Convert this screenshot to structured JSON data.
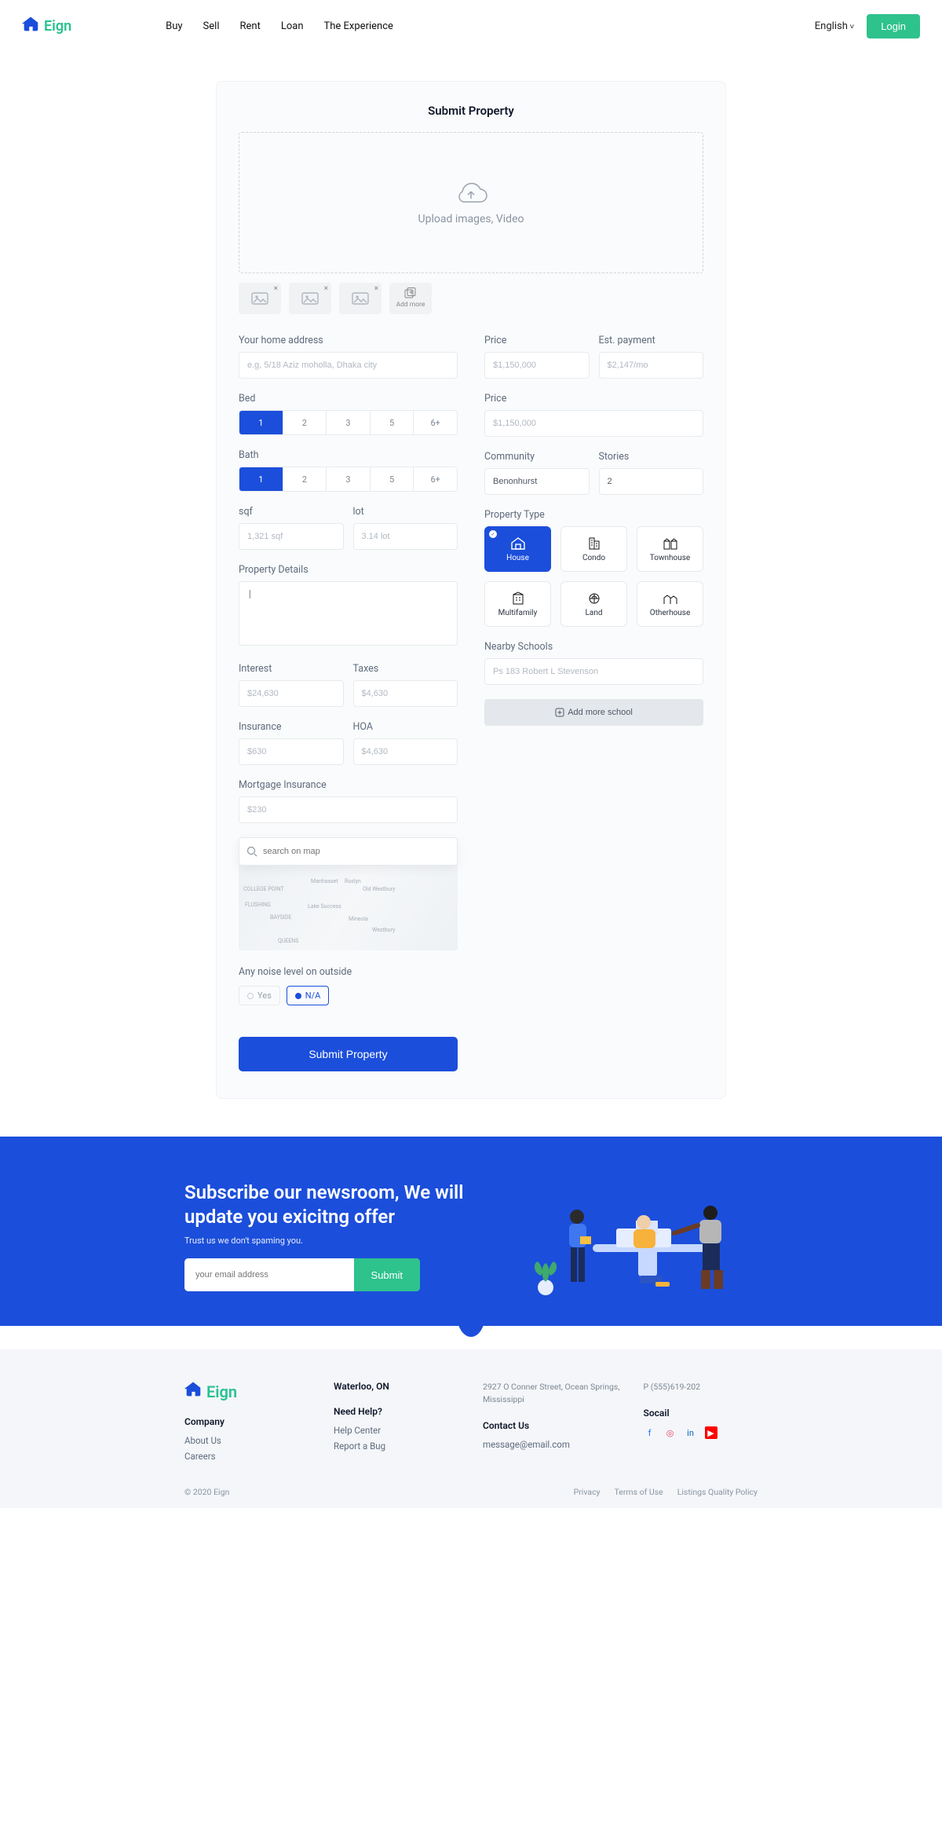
{
  "header": {
    "brand": "Eign",
    "nav": [
      "Buy",
      "Sell",
      "Rent",
      "Loan",
      "The Experience"
    ],
    "language": "English",
    "login": "Login"
  },
  "form": {
    "title": "Submit Property",
    "upload_text": "Upload  images, Video",
    "add_more": "Add more",
    "address_label": "Your home address",
    "address_ph": "e.g, 5/18 Aziz moholla, Dhaka city",
    "bed_label": "Bed",
    "bath_label": "Bath",
    "steps": [
      "1",
      "2",
      "3",
      "5",
      "6+"
    ],
    "sqf_label": "sqf",
    "sqf_ph": "1,321 sqf",
    "lot_label": "lot",
    "lot_ph": "3.14 lot",
    "details_label": "Property Details",
    "interest_label": "Interest",
    "interest_ph": "$24,630",
    "taxes_label": "Taxes",
    "taxes_ph": "$4,630",
    "insurance_label": "Insurance",
    "insurance_ph": "$630",
    "hoa_label": "HOA",
    "hoa_ph": "$4,630",
    "mi_label": "Mortgage Insurance",
    "mi_ph": "$230",
    "map_search_ph": "search on map",
    "noise_label": "Any noise level on outside",
    "noise_yes": "Yes",
    "noise_na": "N/A",
    "submit": "Submit Property",
    "price_label": "Price",
    "price_ph": "$1,150,000",
    "est_label": "Est. payment",
    "est_ph": "$2,147/mo",
    "price2_label": "Price",
    "price2_ph": "$1,150,000",
    "community_label": "Community",
    "community_val": "Benonhurst",
    "stories_label": "Stories",
    "stories_val": "2",
    "type_label": "Property Type",
    "types": [
      "House",
      "Condo",
      "Townhouse",
      "Multifamily",
      "Land",
      "Otherhouse"
    ],
    "schools_label": "Nearby Schools",
    "school_row": "Ps 183 Robert L Stevenson",
    "add_school": "Add more school",
    "map_labels": [
      "COLLEGE POINT",
      "FLUSHING",
      "BAYSIDE",
      "Manhasset",
      "Roslyn",
      "Old Westbury",
      "Lake Success",
      "Mineola",
      "QUEENS",
      "Westbury"
    ]
  },
  "subscribe": {
    "heading": "Subscribe our newsroom, We will update you exicitng offer",
    "sub": "Trust us we don't spaming you.",
    "placeholder": "your email address",
    "button": "Submit"
  },
  "footer": {
    "brand": "Eign",
    "location": "Waterloo, ON",
    "address": "2927  O Conner Street, Ocean Springs, Mississippi",
    "phone": "P (555)619-202",
    "company_h": "Company",
    "company": [
      "About Us",
      "Careers"
    ],
    "help_h": "Need Help?",
    "help": [
      "Help Center",
      "Report a Bug"
    ],
    "contact_h": "Contact Us",
    "email": "message@email.com",
    "social_h": "Socail",
    "copyright": "© 2020 Eign",
    "legal": [
      "Privacy",
      "Terms of Use",
      "Listings Quality Policy"
    ]
  }
}
